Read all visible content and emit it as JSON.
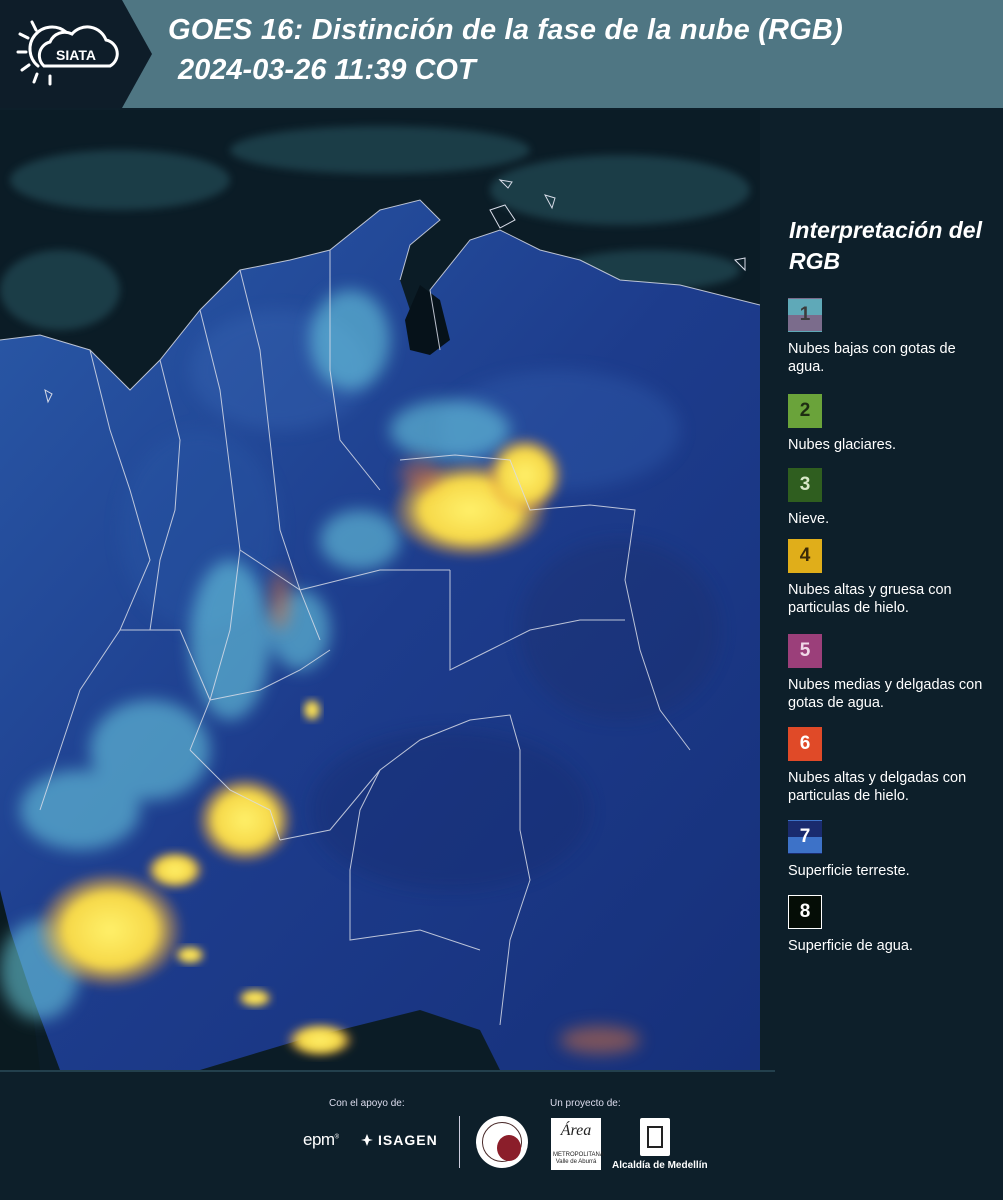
{
  "header": {
    "logo_text": "SIATA",
    "title_line1": "GOES 16: Distinción de la fase de la nube (RGB)",
    "title_line2": "2024-03-26 11:39 COT"
  },
  "legend": {
    "title": "Interpretación del RGB",
    "items": [
      {
        "number": "1",
        "label": "Nubes bajas con gotas de agua.",
        "color_top": "#5fa9b8",
        "color_bottom": "#7b6c8c"
      },
      {
        "number": "2",
        "label": "Nubes glaciares.",
        "color": "#6aa33a"
      },
      {
        "number": "3",
        "label": "Nieve.",
        "color": "#2f5e1f"
      },
      {
        "number": "4",
        "label": "Nubes altas y gruesa con particulas de hielo.",
        "color": "#e0ae1a"
      },
      {
        "number": "5",
        "label": "Nubes medias y delgadas con gotas de agua.",
        "color": "#9b3f7a"
      },
      {
        "number": "6",
        "label": "Nubes altas y delgadas con particulas de hielo.",
        "color": "#e04a28"
      },
      {
        "number": "7",
        "label": "Superficie terreste.",
        "color_top": "#1a2b6e",
        "color_bottom": "#3d72c8"
      },
      {
        "number": "8",
        "label": "Superficie de agua.",
        "color": "#050d06"
      }
    ]
  },
  "footer": {
    "support_label": "Con el apoyo de:",
    "project_label": "Un proyecto de:",
    "epm": "epm",
    "isagen": "ISAGEN",
    "area_name": "Área",
    "area_sub": "METROPOLITANA Valle de Aburrá",
    "medellin": "Alcaldía de Medellín"
  },
  "colors": {
    "header_bg": "#4f7683",
    "panel_bg": "#0d1f2a",
    "land": "#1e3d8a",
    "ocean": "#0a1a24",
    "cloud_thick": "#f6e24a",
    "cloud_low": "#5fd0e0"
  }
}
